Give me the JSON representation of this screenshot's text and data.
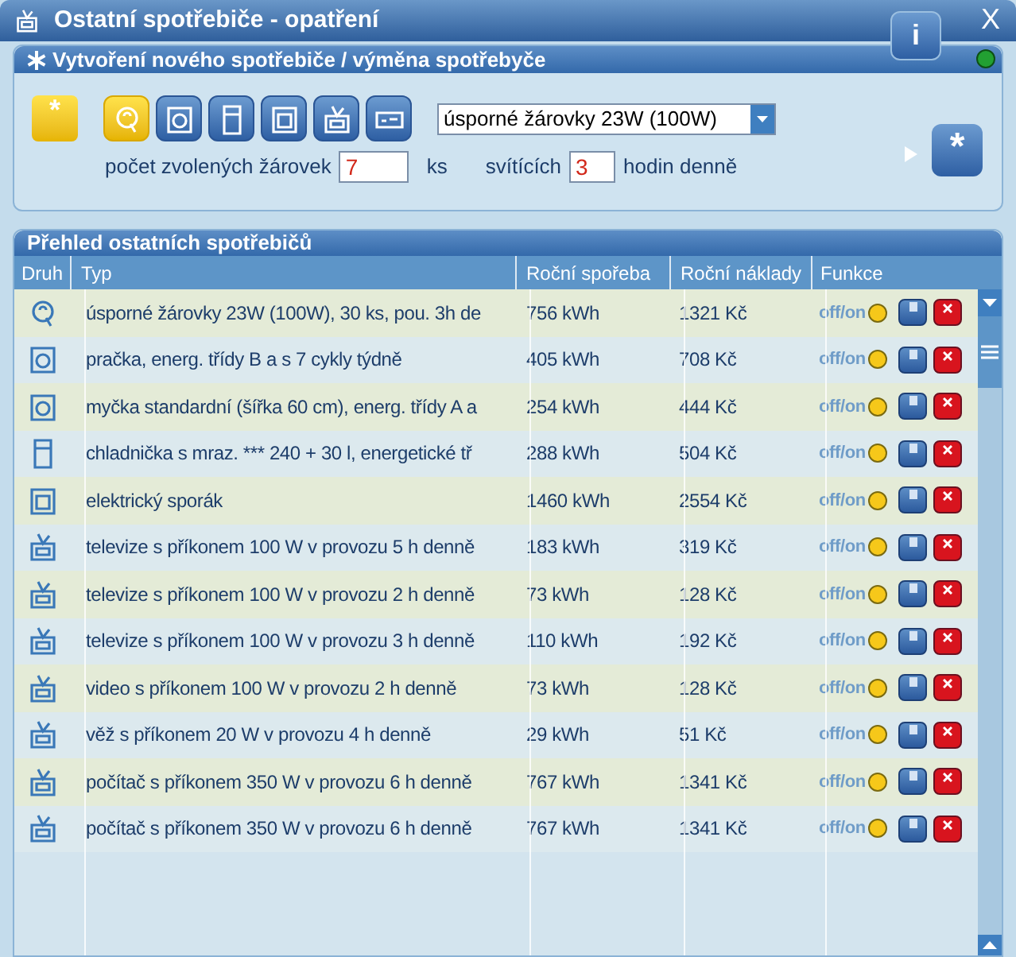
{
  "window": {
    "title": "Ostatní spotřebiče - opatření",
    "info_button": "i",
    "close_button": "X"
  },
  "create_panel": {
    "title": "Vytvoření nového spotřebiče / výměna spotřebyče",
    "new_button": "*",
    "appliances": [
      {
        "kind": "bulb",
        "selected": true
      },
      {
        "kind": "washer",
        "selected": false
      },
      {
        "kind": "fridge",
        "selected": false
      },
      {
        "kind": "stove",
        "selected": false
      },
      {
        "kind": "tv",
        "selected": false
      },
      {
        "kind": "video",
        "selected": false
      }
    ],
    "dropdown": {
      "value": "úsporné žárovky 23W (100W)"
    },
    "count_label": "počet zvolených žárovek",
    "count": "7",
    "count_unit": "ks",
    "hours_label": "svítících",
    "hours": "3",
    "hours_unit": "hodin denně",
    "add_button": "*"
  },
  "overview": {
    "title": "Přehled ostatních spotřebičů",
    "columns": [
      "Druh",
      "Typ",
      "Roční spořeba",
      "Roční náklady",
      "Funkce"
    ],
    "rows": [
      {
        "kind": "bulb",
        "type": "úsporné žárovky 23W (100W), 30 ks, pou. 3h de",
        "savings": "756 kWh",
        "cost": "1321 Kč",
        "toggle": "off/**on**"
      },
      {
        "kind": "washer",
        "type": "pračka, energ. třídy B a s 7 cykly týdně",
        "savings": "405 kWh",
        "cost": "708 Kč",
        "toggle": "off/**on**"
      },
      {
        "kind": "washer",
        "type": "myčka standardní (šířka 60 cm), energ. třídy A a",
        "savings": "254 kWh",
        "cost": "444 Kč",
        "toggle": "off/**on**"
      },
      {
        "kind": "fridge",
        "type": "chladnička s mraz.  ***  240 + 30 l, energetické tř",
        "savings": "288 kWh",
        "cost": "504 Kč",
        "toggle": "off/**on**"
      },
      {
        "kind": "stove",
        "type": "elektrický sporák",
        "savings": "1460 kWh",
        "cost": "2554 Kč",
        "toggle": "off/**on**"
      },
      {
        "kind": "tv",
        "type": "televize s příkonem 100 W v provozu 5 h denně",
        "savings": "183 kWh",
        "cost": "319 Kč",
        "toggle": "off/**on**"
      },
      {
        "kind": "tv",
        "type": "televize s příkonem 100 W v provozu 2 h denně",
        "savings": "73 kWh",
        "cost": "128 Kč",
        "toggle": "off/**on**"
      },
      {
        "kind": "tv",
        "type": "televize s příkonem 100 W v provozu 3 h denně",
        "savings": "110 kWh",
        "cost": "192 Kč",
        "toggle": "off/**on**"
      },
      {
        "kind": "tv",
        "type": "video s příkonem 100 W v provozu 2 h denně",
        "savings": "73 kWh",
        "cost": "128 Kč",
        "toggle": "off/**on**"
      },
      {
        "kind": "tv",
        "type": "věž  s příkonem 20 W v provozu 4 h denně",
        "savings": "29 kWh",
        "cost": "51 Kč",
        "toggle": "off/**on**"
      },
      {
        "kind": "tv",
        "type": "počítač s příkonem 350 W v provozu 6 h denně",
        "savings": "767 kWh",
        "cost": "1341 Kč",
        "toggle": "off/**on**"
      },
      {
        "kind": "tv",
        "type": "počítač s příkonem 350 W v provozu 6 h denně",
        "savings": "767 kWh",
        "cost": "1341 Kč",
        "toggle": "off/**on**"
      }
    ]
  }
}
